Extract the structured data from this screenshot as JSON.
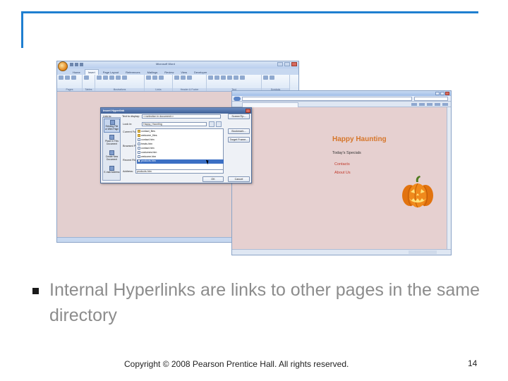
{
  "slide": {
    "bullet": "Internal Hyperlinks are links to other pages in the same directory",
    "footer": "Copyright © 2008 Pearson Prentice Hall. All rights reserved.",
    "page_number": "14",
    "accent_color": "#1f7fd0"
  },
  "word_window": {
    "title": "Microsoft Word",
    "tabs": [
      "Home",
      "Insert",
      "Page Layout",
      "References",
      "Mailings",
      "Review",
      "View",
      "Developer"
    ],
    "active_tab": "Insert",
    "ribbon_groups": [
      "Pages",
      "Tables",
      "Illustrations",
      "Links",
      "Header & Footer",
      "Text",
      "Symbols"
    ]
  },
  "dialog": {
    "title": "Insert Hyperlink",
    "text_to_display_label": "Text to display:",
    "text_to_display_value": "<<selection in document>>",
    "screentip_button": "ScreenTip...",
    "link_to_label": "Link to:",
    "link_to_options": [
      "Existing File or Web Page",
      "Place in This Document",
      "Create New Document",
      "E-mail Address"
    ],
    "look_in_label": "Look in:",
    "look_in_value": "Happy_Haunting",
    "side_options": [
      "Current Folder",
      "Browsed Pages",
      "Recent Files"
    ],
    "files": [
      "contact_files",
      "welcome_files",
      "contact.htm",
      "treats.htm",
      "contact.htm",
      "costumes.htm",
      "welcome.htm",
      "products.htm"
    ],
    "selected_file_index": 7,
    "right_buttons": [
      "Bookmark...",
      "Target Frame..."
    ],
    "address_label": "Address:",
    "address_value": "products.htm",
    "ok_button": "OK",
    "cancel_button": "Cancel"
  },
  "browser": {
    "page_heading": "Happy Haunting",
    "page_subheading": "Today's Specials",
    "links": [
      "Contacts",
      "About Us"
    ]
  }
}
